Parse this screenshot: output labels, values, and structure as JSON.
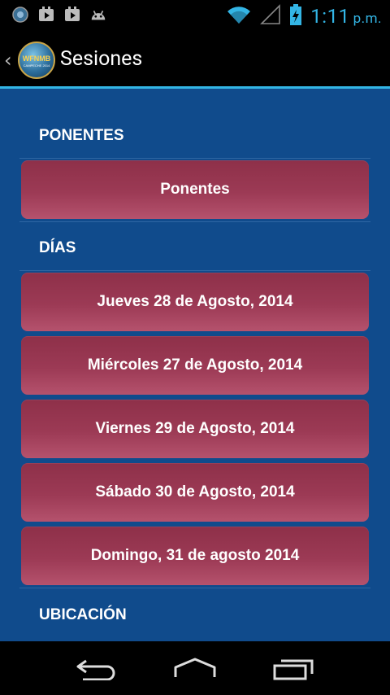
{
  "status_bar": {
    "time": "1:11",
    "ampm": "p.m.",
    "icons": [
      "app-logo-icon",
      "play-store-icon",
      "play-store-icon",
      "android-icon",
      "wifi-icon",
      "signal-icon",
      "battery-charging-icon"
    ]
  },
  "action_bar": {
    "title": "Sesiones",
    "logo_text": "WFNMB",
    "logo_sub": "CAMPECHE 2014"
  },
  "sections": {
    "ponentes_header": "PONENTES",
    "ponentes_button": "Ponentes",
    "dias_header": "DÍAS",
    "dias": [
      "Jueves 28 de Agosto, 2014",
      "Miércoles 27 de Agosto, 2014",
      "Viernes 29 de Agosto, 2014",
      "Sábado 30 de Agosto, 2014",
      "Domingo, 31 de agosto 2014"
    ],
    "ubicacion_header": "UBICACIÓN"
  },
  "colors": {
    "accent": "#33b5e5",
    "background": "#104b8c",
    "button": "#9c3a55"
  }
}
